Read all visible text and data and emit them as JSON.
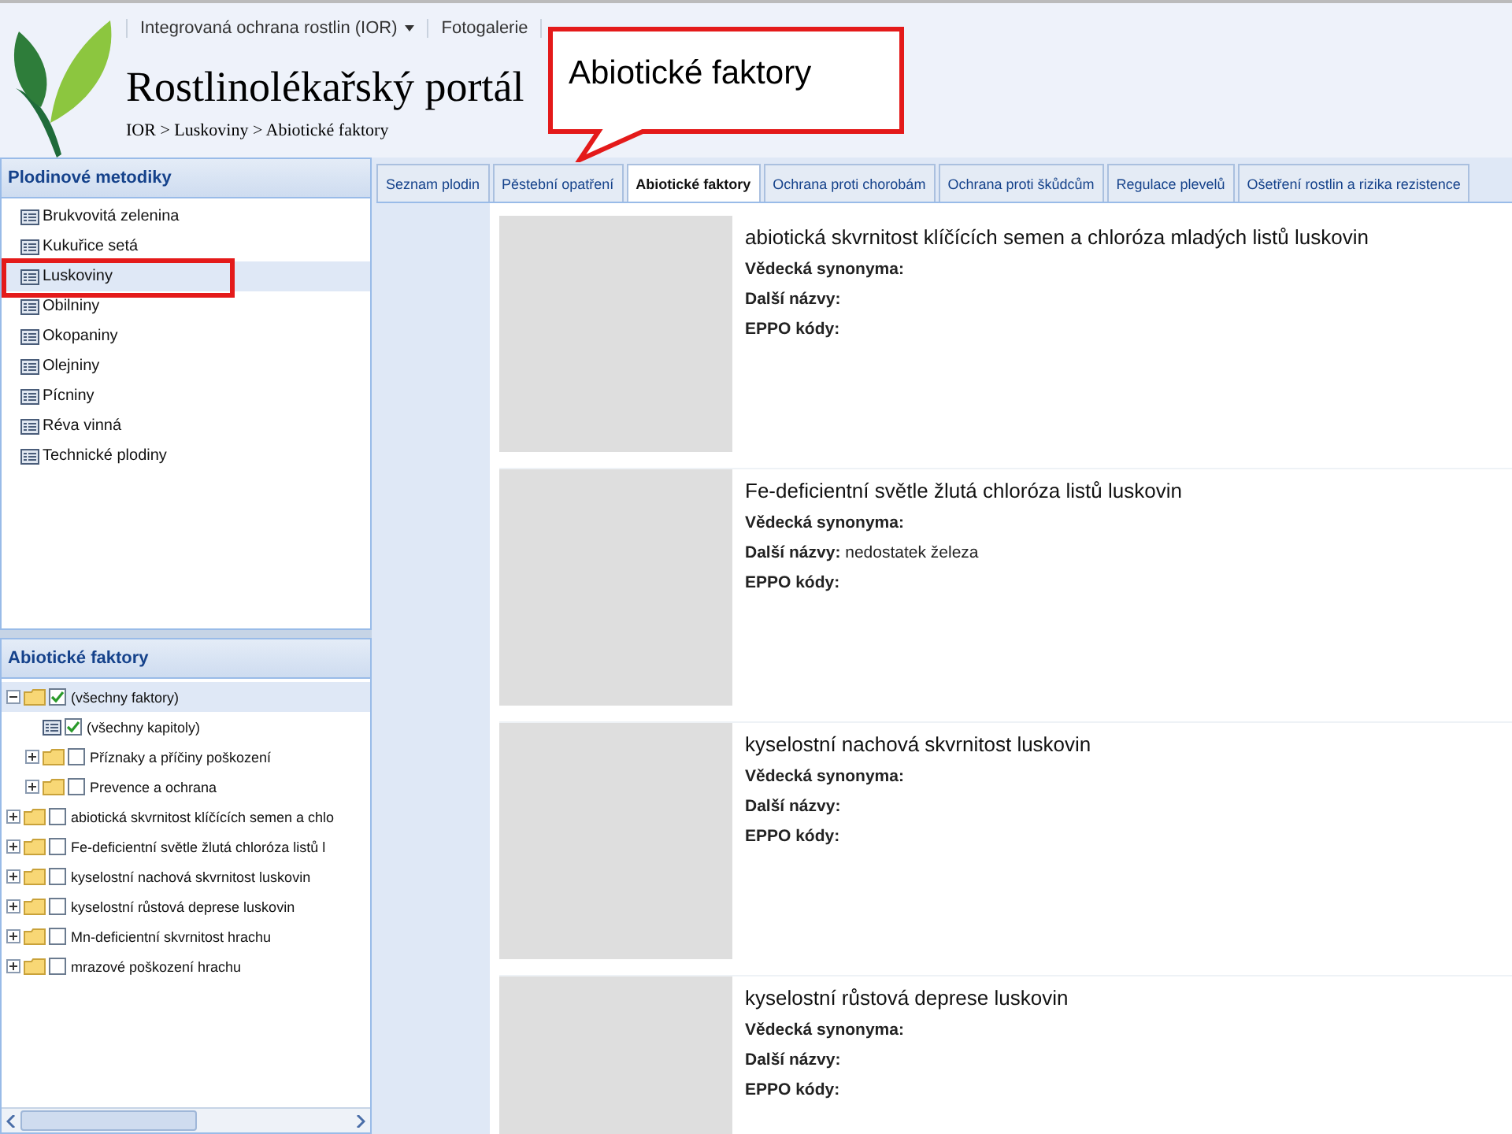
{
  "header": {
    "nav": [
      {
        "label": "Integrovaná ochrana rostlin (IOR)",
        "dropdown": true
      },
      {
        "label": "Fotogalerie",
        "dropdown": false
      }
    ],
    "title": "Rostlinolékařský portál",
    "breadcrumb": "IOR > Luskoviny > Abiotické faktory"
  },
  "callout": {
    "text": "Abiotické faktory"
  },
  "crops_panel": {
    "title": "Plodinové metodiky",
    "items": [
      {
        "label": "Brukvovitá zelenina",
        "selected": false,
        "marked": false
      },
      {
        "label": "Kukuřice setá",
        "selected": false,
        "marked": false
      },
      {
        "label": "Luskoviny",
        "selected": true,
        "marked": true
      },
      {
        "label": "Obilniny",
        "selected": false,
        "marked": false
      },
      {
        "label": "Okopaniny",
        "selected": false,
        "marked": false
      },
      {
        "label": "Olejniny",
        "selected": false,
        "marked": false
      },
      {
        "label": "Pícniny",
        "selected": false,
        "marked": false
      },
      {
        "label": "Réva vinná",
        "selected": false,
        "marked": false
      },
      {
        "label": "Technické plodiny",
        "selected": false,
        "marked": false
      }
    ]
  },
  "factors_panel": {
    "title": "Abiotické faktory",
    "tree": [
      {
        "label": "(všechny faktory)",
        "kind": "folder",
        "expanded": true,
        "checked": true,
        "selected": true,
        "children": [
          {
            "label": "(všechny kapitoly)",
            "kind": "document",
            "checked": true,
            "selected": false
          },
          {
            "label": "Příznaky a příčiny poškození",
            "kind": "folder",
            "expanded": false,
            "checked": false,
            "selected": false
          },
          {
            "label": "Prevence a ochrana",
            "kind": "folder",
            "expanded": false,
            "checked": false,
            "selected": false
          }
        ]
      },
      {
        "label": "abiotická skvrnitost klíčících semen a chlo",
        "kind": "folder",
        "expanded": false,
        "checked": false,
        "selected": false
      },
      {
        "label": "Fe-deficientní světle žlutá chloróza listů l",
        "kind": "folder",
        "expanded": false,
        "checked": false,
        "selected": false
      },
      {
        "label": "kyselostní nachová skvrnitost luskovin",
        "kind": "folder",
        "expanded": false,
        "checked": false,
        "selected": false
      },
      {
        "label": "kyselostní růstová deprese luskovin",
        "kind": "folder",
        "expanded": false,
        "checked": false,
        "selected": false
      },
      {
        "label": "Mn-deficientní skvrnitost hrachu",
        "kind": "folder",
        "expanded": false,
        "checked": false,
        "selected": false
      },
      {
        "label": "mrazové poškození hrachu",
        "kind": "folder",
        "expanded": false,
        "checked": false,
        "selected": false
      }
    ]
  },
  "tabs": [
    {
      "label": "Seznam plodin",
      "selected": false
    },
    {
      "label": "Pěstební opatření",
      "selected": false
    },
    {
      "label": "Abiotické faktory",
      "selected": true
    },
    {
      "label": "Ochrana proti chorobám",
      "selected": false
    },
    {
      "label": "Ochrana proti škůdcům",
      "selected": false
    },
    {
      "label": "Regulace plevelů",
      "selected": false
    },
    {
      "label": "Ošetření rostlin a rizika rezistence",
      "selected": false
    }
  ],
  "entries": [
    {
      "title": "abiotická skvrnitost klíčících semen a chloróza mladých listů luskovin",
      "fields": [
        {
          "label": "Vědecká synonyma:"
        },
        {
          "label": "Další názvy:"
        },
        {
          "label": "EPPO kódy:"
        }
      ]
    },
    {
      "title": "Fe-deficientní světle žlutá chloróza listů luskovin",
      "fields": [
        {
          "label": "Vědecká synonyma:"
        },
        {
          "label": "Další názvy:",
          "value": "nedostatek železa"
        },
        {
          "label": "EPPO kódy:"
        }
      ]
    },
    {
      "title": "kyselostní nachová skvrnitost luskovin",
      "fields": [
        {
          "label": "Vědecká synonyma:"
        },
        {
          "label": "Další názvy:"
        },
        {
          "label": "EPPO kódy:"
        }
      ]
    },
    {
      "title": "kyselostní růstová deprese luskovin",
      "fields": [
        {
          "label": "Vědecká synonyma:"
        },
        {
          "label": "Další názvy:"
        },
        {
          "label": "EPPO kódy:"
        }
      ]
    }
  ]
}
